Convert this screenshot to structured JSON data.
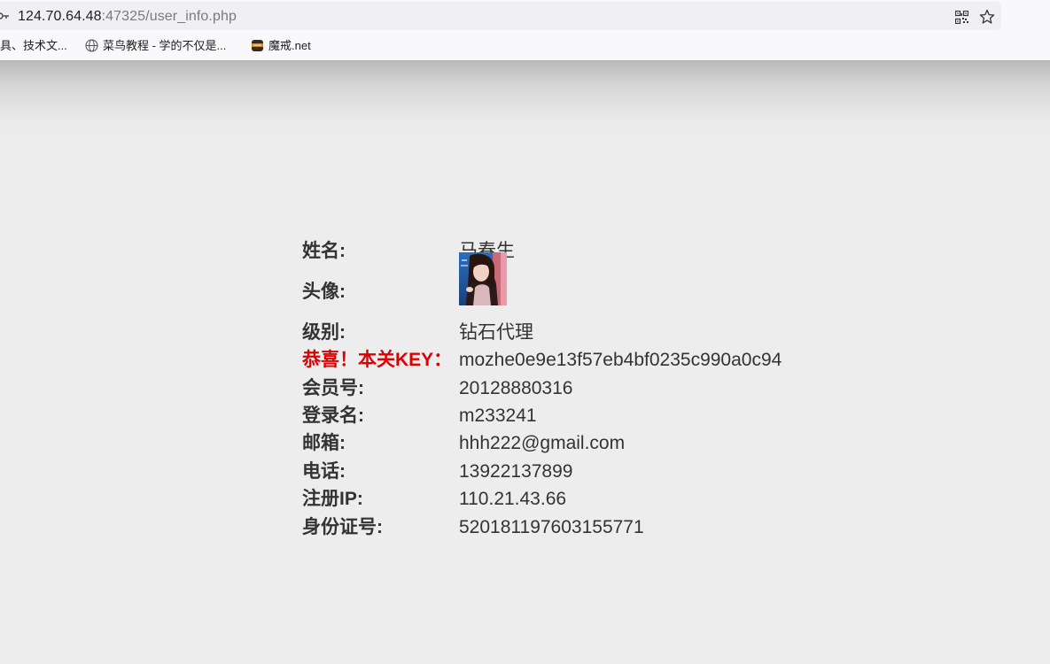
{
  "browser": {
    "url_host": "124.70.64.48",
    "url_path": ":47325/user_info.php",
    "bookmarks": [
      {
        "label": "具、技术文...",
        "icon": "none"
      },
      {
        "label": "菜鸟教程 - 学的不仅是...",
        "icon": "globe-icon"
      },
      {
        "label": "魔戒.net",
        "icon": "site-favicon"
      }
    ]
  },
  "profile": {
    "name_label": "姓名:",
    "name_value": "马春生",
    "avatar_label": "头像:",
    "level_label": "级别:",
    "level_value": "钻石代理",
    "key_label": "恭喜！本关KEY：",
    "key_value": "mozhe0e9e13f57eb4bf0235c990a0c94",
    "member_label": "会员号:",
    "member_value": "20128880316",
    "login_label": "登录名:",
    "login_value": "m233241",
    "email_label": "邮箱:",
    "email_value": "hhh222@gmail.com",
    "phone_label": "电话:",
    "phone_value": "13922137899",
    "ip_label": "注册IP:",
    "ip_value": "110.21.43.66",
    "id_label": "身份证号:",
    "id_value": "520181197603155771"
  },
  "colors": {
    "key_label": "#e00000",
    "text": "#333333",
    "background": "#eeeded"
  }
}
